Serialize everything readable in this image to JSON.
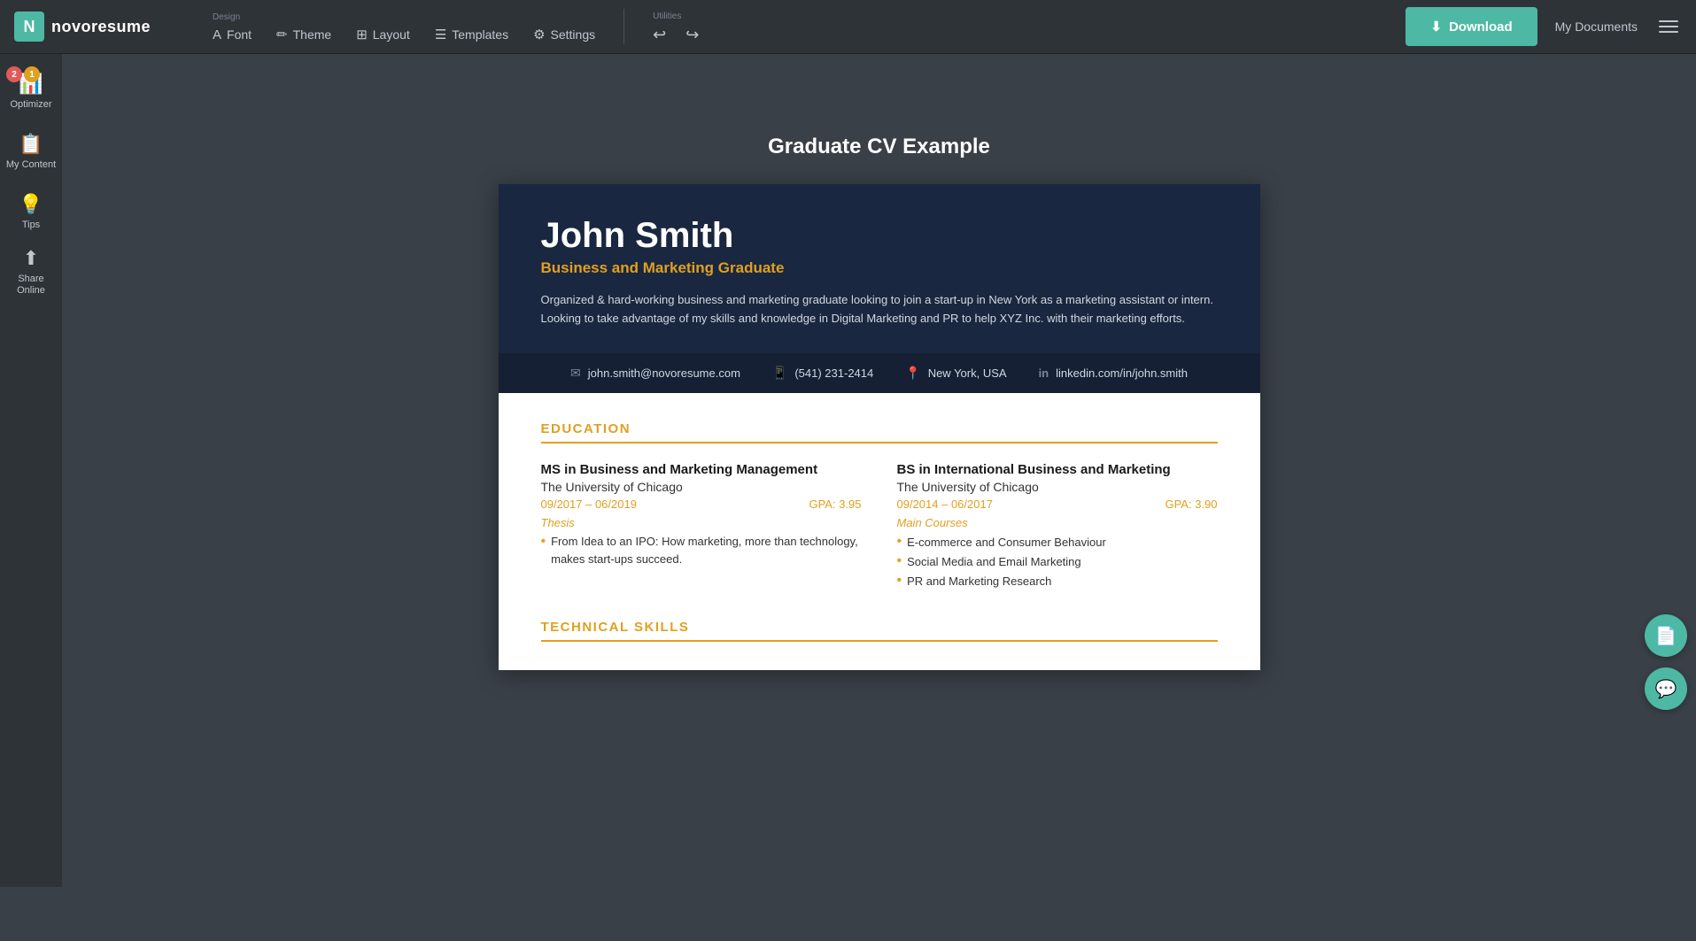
{
  "app": {
    "logo_letter": "N",
    "logo_name": "novoresume"
  },
  "nav": {
    "design_label": "Design",
    "utilities_label": "Utilities",
    "font_label": "Font",
    "theme_label": "Theme",
    "layout_label": "Layout",
    "templates_label": "Templates",
    "settings_label": "Settings",
    "download_label": "Download",
    "my_documents_label": "My Documents"
  },
  "sidebar": {
    "optimizer_label": "Optimizer",
    "my_content_label": "My Content",
    "tips_label": "Tips",
    "share_online_label": "Share Online",
    "badge_red": "2",
    "badge_yellow": "1"
  },
  "page": {
    "title": "Graduate CV Example"
  },
  "cv": {
    "name": "John Smith",
    "title": "Business and Marketing Graduate",
    "summary": "Organized & hard-working business and marketing graduate looking to join a start-up in New York as a marketing assistant or intern. Looking to take advantage of my skills and knowledge in Digital Marketing and PR to help XYZ Inc. with their marketing efforts.",
    "contact": {
      "email": "john.smith@novoresume.com",
      "phone": "(541) 231-2414",
      "location": "New York, USA",
      "linkedin": "linkedin.com/in/john.smith"
    },
    "education": {
      "section_title": "EDUCATION",
      "items": [
        {
          "degree": "MS in Business and Marketing Management",
          "school": "The University of Chicago",
          "dates": "09/2017 – 06/2019",
          "gpa": "GPA: 3.95",
          "sub_label": "Thesis",
          "thesis": "From Idea to an IPO: How marketing, more than technology, makes start-ups succeed."
        },
        {
          "degree": "BS in International Business and Marketing",
          "school": "The University of Chicago",
          "dates": "09/2014 – 06/2017",
          "gpa": "GPA: 3.90",
          "sub_label": "Main Courses",
          "courses": [
            "E-commerce and Consumer Behaviour",
            "Social Media and Email Marketing",
            "PR and Marketing Research"
          ]
        }
      ]
    },
    "technical_skills_title": "TECHNICAL SKILLS"
  },
  "floating_buttons": {
    "doc_icon": "📄",
    "chat_icon": "💬"
  }
}
